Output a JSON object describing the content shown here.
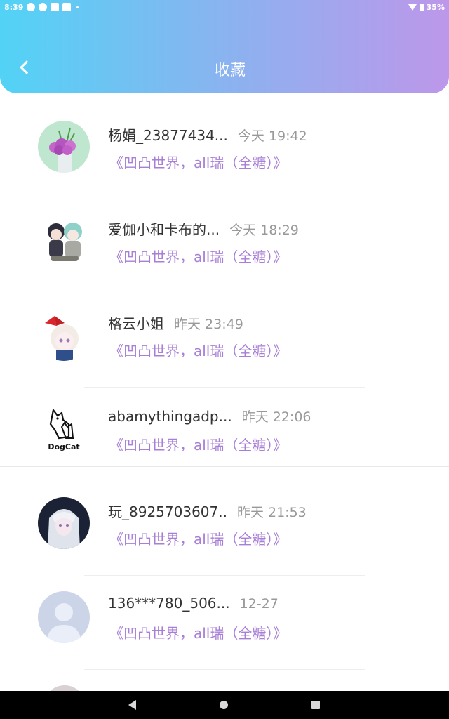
{
  "status_bar": {
    "time": "8:39",
    "battery": "35%",
    "icons": [
      "hotspot-icon",
      "qq-icon",
      "notification-icon",
      "notification-icon",
      "dot-icon",
      "wifi-icon",
      "battery-icon"
    ]
  },
  "header": {
    "title": "收藏",
    "back_icon": "chevron-left-icon",
    "gradient": [
      "#52d3f6",
      "#bd97ea"
    ]
  },
  "favorites": [
    {
      "name": "杨娟_23877434...",
      "time": "今天 19:42",
      "work": "《凹凸世界，all瑞（全糖）》",
      "avatar": "flower-vase-avatar"
    },
    {
      "name": "爱伽小和卡布的...",
      "time": "今天 18:29",
      "work": "《凹凸世界，all瑞（全糖）》",
      "avatar": "anime-couple-avatar"
    },
    {
      "name": "格云小姐",
      "time": "昨天 23:49",
      "work": "《凹凸世界，all瑞（全糖）》",
      "avatar": "anime-girl-bow-avatar"
    },
    {
      "name": "abamythingadp...",
      "time": "昨天 22:06",
      "work": "《凹凸世界，all瑞（全糖）》",
      "avatar": "dogcat-logo-avatar",
      "avatar_text": "DogCat"
    },
    {
      "name": "玩_8925703607..",
      "time": "昨天 21:53",
      "work": "《凹凸世界，all瑞（全糖）》",
      "avatar": "white-hair-anime-avatar"
    },
    {
      "name": "136***780_506...",
      "time": "12-27",
      "work": "《凹凸世界，all瑞（全糖）》",
      "avatar": "default-user-avatar"
    }
  ],
  "colors": {
    "work_title": "#a87fd6",
    "time": "#999999",
    "name": "#333333"
  },
  "nav_bar": {
    "icons": [
      "nav-back-icon",
      "nav-home-icon",
      "nav-recent-icon"
    ]
  }
}
